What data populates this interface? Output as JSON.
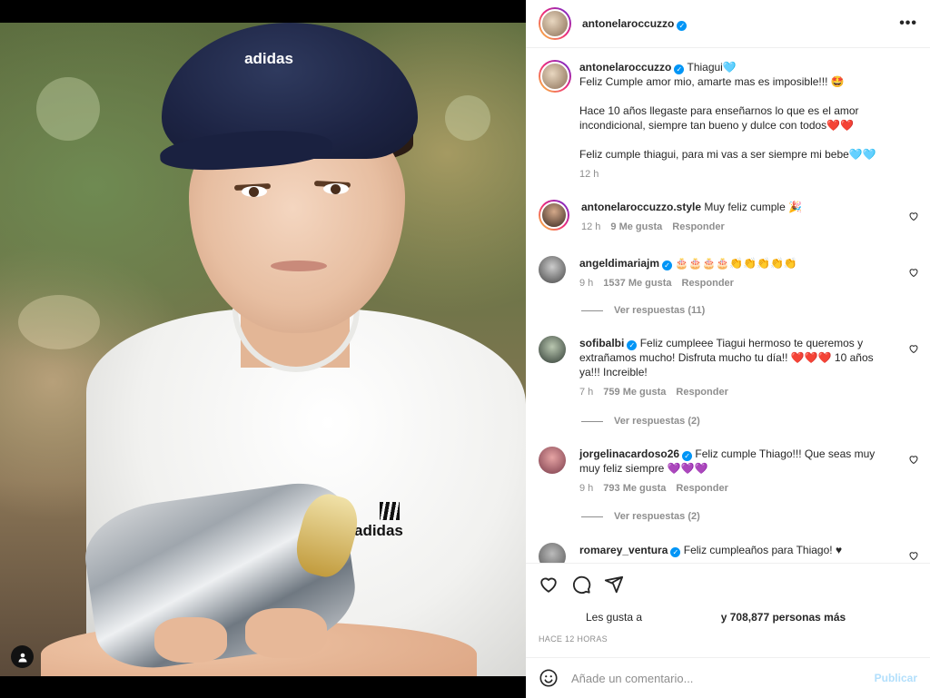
{
  "post": {
    "author": "antonelaroccuzzo",
    "verified": true,
    "more_icon": "more-horizontal-icon",
    "photo": {
      "cap_brand": "adidas",
      "shirt_brand": "adidas",
      "user_tag_icon": "user-tag-icon"
    }
  },
  "caption": {
    "username": "antonelaroccuzzo",
    "tag": "Thiagui🩵",
    "line1": "Feliz Cumple amor mio, amarte mas es imposible!!! 🤩",
    "line2": "Hace 10 años llegaste para enseñarnos lo que es el amor incondicional, siempre tan bueno y dulce con todos❤️❤️",
    "line3": "Feliz cumple thiagui, para mi vas a ser siempre mi bebe🩵🩵",
    "time": "12 h"
  },
  "comments": [
    {
      "username": "antonelaroccuzzo.style",
      "verified": false,
      "text": "Muy feliz cumple 🎉",
      "time": "12 h",
      "likes": "9 Me gusta",
      "reply": "Responder",
      "replies": null
    },
    {
      "username": "angeldimariajm",
      "verified": true,
      "text": "🎂🎂🎂🎂👏👏👏👏👏",
      "time": "9 h",
      "likes": "1537 Me gusta",
      "reply": "Responder",
      "replies": "Ver respuestas (11)"
    },
    {
      "username": "sofibalbi",
      "verified": true,
      "text": "Feliz cumpleee Tiagui hermoso te queremos y extrañamos mucho! Disfruta mucho tu día!! ❤️❤️❤️ 10 años ya!!! Increible!",
      "time": "7 h",
      "likes": "759 Me gusta",
      "reply": "Responder",
      "replies": "Ver respuestas (2)"
    },
    {
      "username": "jorgelinacardoso26",
      "verified": true,
      "text": "Feliz cumple Thiago!!! Que seas muy muy feliz siempre 💜💜💜",
      "time": "9 h",
      "likes": "793 Me gusta",
      "reply": "Responder",
      "replies": "Ver respuestas (2)"
    },
    {
      "username": "romarey_ventura",
      "verified": true,
      "text": "Feliz cumpleaños para Thiago! ♥",
      "time": "",
      "likes": "",
      "reply": "",
      "replies": null
    }
  ],
  "actions": {
    "like_icon": "heart-icon",
    "comment_icon": "comment-icon",
    "share_icon": "share-icon",
    "likes_prefix": "Les gusta a",
    "likes_suffix": "y 708,877 personas más",
    "timestamp": "HACE 12 HORAS"
  },
  "add_comment": {
    "emoji_icon": "emoji-icon",
    "placeholder": "Añade un comentario...",
    "publish_label": "Publicar"
  },
  "colors": {
    "link_blue": "#0095f6",
    "publish_disabled": "#b2dffc",
    "muted": "#8e8e8e",
    "text": "#262626"
  }
}
